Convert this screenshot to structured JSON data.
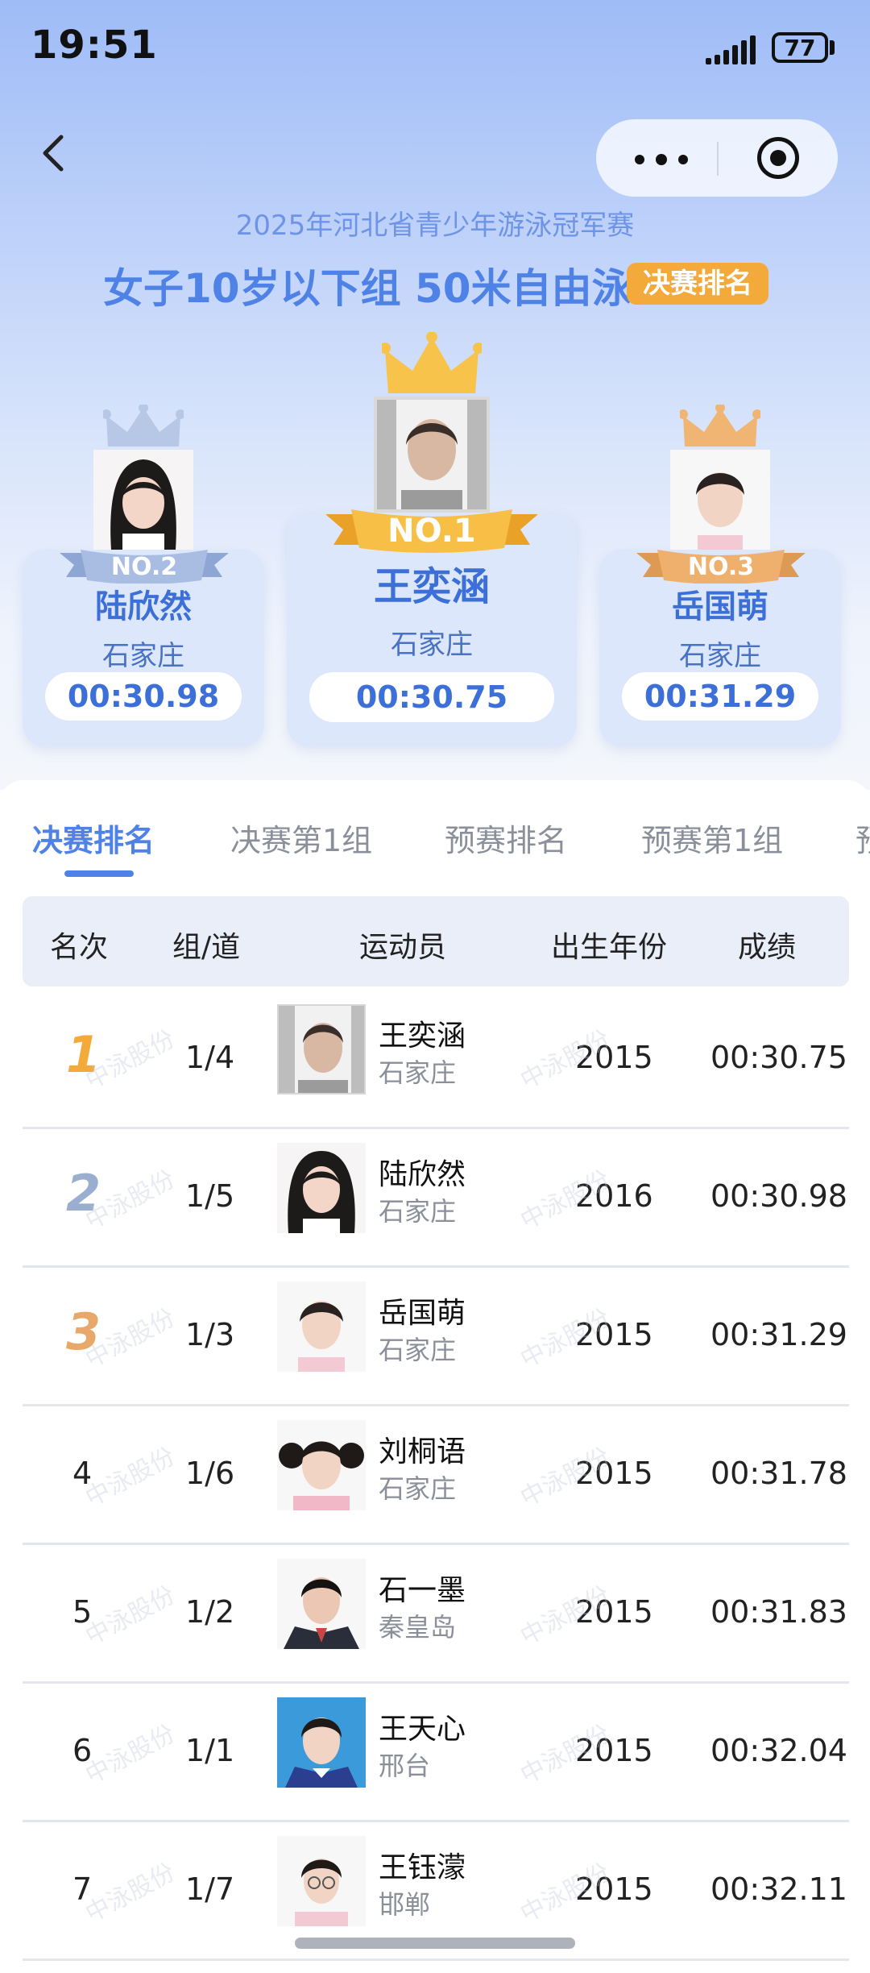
{
  "status": {
    "time": "19:51",
    "battery": "77"
  },
  "header": {
    "event": "2025年河北省青少年游泳冠军赛",
    "title": "女子10岁以下组 50米自由泳",
    "badge": "决赛排名"
  },
  "podium": [
    {
      "place": "NO.2",
      "name": "陆欣然",
      "city": "石家庄",
      "time": "00:30.98"
    },
    {
      "place": "NO.1",
      "name": "王奕涵",
      "city": "石家庄",
      "time": "00:30.75"
    },
    {
      "place": "NO.3",
      "name": "岳国萌",
      "city": "石家庄",
      "time": "00:31.29"
    }
  ],
  "tabs": [
    "决赛排名",
    "决赛第1组",
    "预赛排名",
    "预赛第1组",
    "预"
  ],
  "table": {
    "headers": [
      "名次",
      "组/道",
      "运动员",
      "出生年份",
      "成绩"
    ],
    "rows": [
      {
        "rank": "1",
        "lane": "1/4",
        "name": "王奕涵",
        "city": "石家庄",
        "year": "2015",
        "result": "00:30.75"
      },
      {
        "rank": "2",
        "lane": "1/5",
        "name": "陆欣然",
        "city": "石家庄",
        "year": "2016",
        "result": "00:30.98"
      },
      {
        "rank": "3",
        "lane": "1/3",
        "name": "岳国萌",
        "city": "石家庄",
        "year": "2015",
        "result": "00:31.29"
      },
      {
        "rank": "4",
        "lane": "1/6",
        "name": "刘桐语",
        "city": "石家庄",
        "year": "2015",
        "result": "00:31.78"
      },
      {
        "rank": "5",
        "lane": "1/2",
        "name": "石一墨",
        "city": "秦皇岛",
        "year": "2015",
        "result": "00:31.83"
      },
      {
        "rank": "6",
        "lane": "1/1",
        "name": "王天心",
        "city": "邢台",
        "year": "2015",
        "result": "00:32.04"
      },
      {
        "rank": "7",
        "lane": "1/7",
        "name": "王钰濛",
        "city": "邯郸",
        "year": "2015",
        "result": "00:32.11"
      }
    ]
  },
  "watermark": "中泳股份",
  "colors": {
    "accent": "#4f82e6",
    "gold": "#f4a93b",
    "silver": "#9aaed0",
    "bronze": "#e8a86a"
  }
}
